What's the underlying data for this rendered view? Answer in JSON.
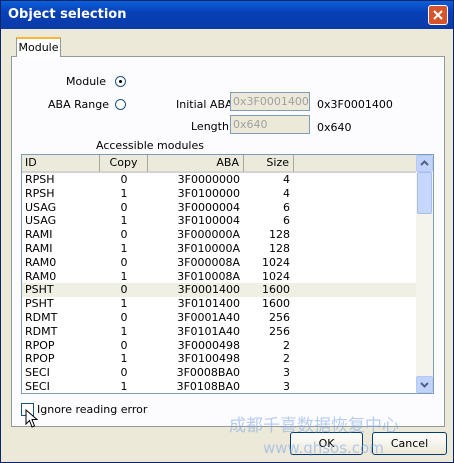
{
  "window": {
    "title": "Object selection",
    "close_glyph": "✕"
  },
  "tabs": [
    {
      "label": "Module"
    }
  ],
  "options": {
    "module_label": "Module",
    "aba_range_label": "ABA Range",
    "selected": "Module"
  },
  "aba": {
    "initial_label": "Initial ABA",
    "initial_value": "0x3F0001400",
    "initial_display": "0x3F0001400",
    "length_label": "Length",
    "length_value": "0x640",
    "length_display": "0x640"
  },
  "list": {
    "title": "Accessible modules",
    "columns": [
      "ID",
      "Copy",
      "ABA",
      "Size"
    ],
    "rows": [
      [
        "RPSH",
        "0",
        "3F0000000",
        "4"
      ],
      [
        "RPSH",
        "1",
        "3F0100000",
        "4"
      ],
      [
        "USAG",
        "0",
        "3F0000004",
        "6"
      ],
      [
        "USAG",
        "1",
        "3F0100004",
        "6"
      ],
      [
        "RAMI",
        "0",
        "3F000000A",
        "128"
      ],
      [
        "RAMI",
        "1",
        "3F010000A",
        "128"
      ],
      [
        "RAM0",
        "0",
        "3F000008A",
        "1024"
      ],
      [
        "RAM0",
        "1",
        "3F010008A",
        "1024"
      ],
      [
        "PSHT",
        "0",
        "3F0001400",
        "1600"
      ],
      [
        "PSHT",
        "1",
        "3F0101400",
        "1600"
      ],
      [
        "RDMT",
        "0",
        "3F0001A40",
        "256"
      ],
      [
        "RDMT",
        "1",
        "3F0101A40",
        "256"
      ],
      [
        "RPOP",
        "0",
        "3F0000498",
        "2"
      ],
      [
        "RPOP",
        "1",
        "3F0100498",
        "2"
      ],
      [
        "SECI",
        "0",
        "3F0008BA0",
        "3"
      ],
      [
        "SECI",
        "1",
        "3F0108BA0",
        "3"
      ]
    ],
    "selected_row": 8
  },
  "footer": {
    "ignore_label": "Ignore reading error",
    "ignore_checked": false,
    "ok_label": "OK",
    "cancel_label": "Cancel"
  },
  "watermark": {
    "line1": "成都千喜数据恢复中心",
    "line2": "www.qhsos.com"
  }
}
